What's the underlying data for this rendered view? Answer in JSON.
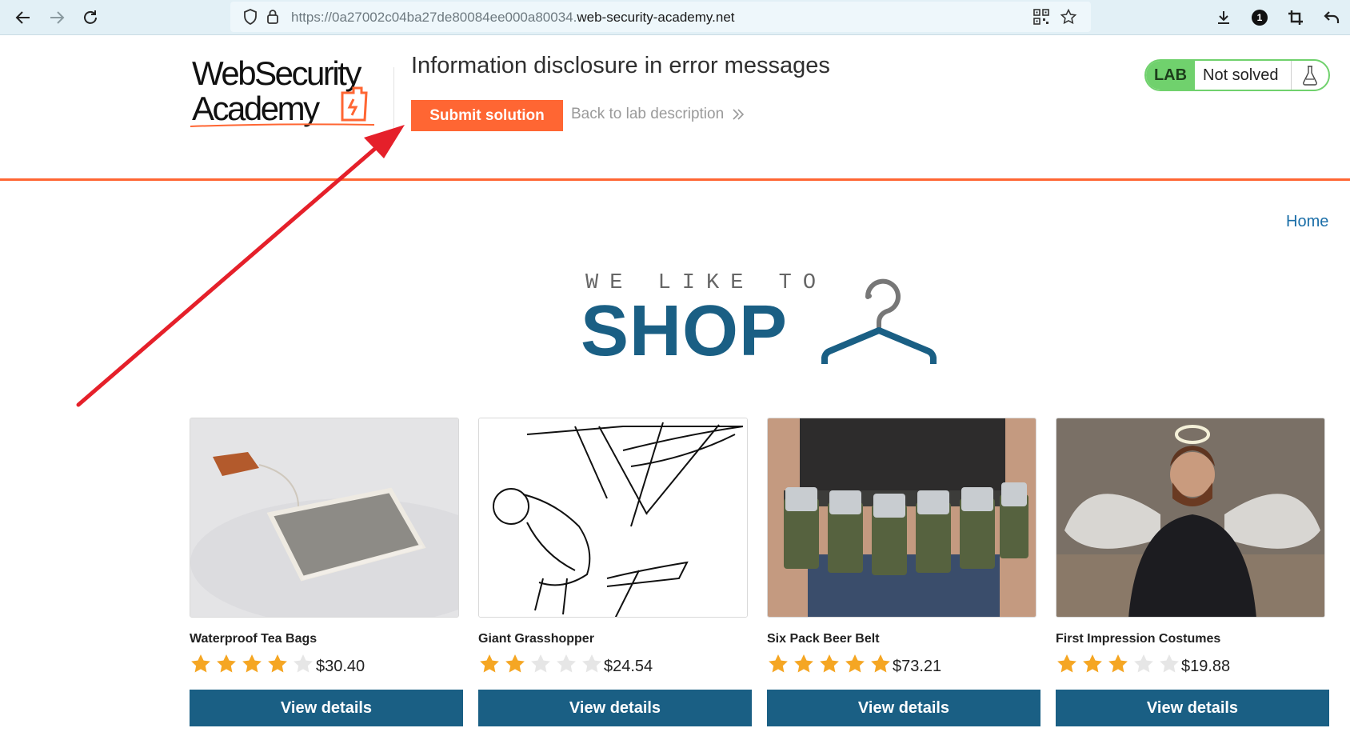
{
  "browser": {
    "url_prefix": "https://0a27002c04ba27de80084ee000a80034.",
    "url_domain": "web-security-academy.net",
    "extensions_badge": "1",
    "icons": [
      "back-arrow-icon",
      "forward-arrow-icon",
      "reload-icon",
      "shield-icon",
      "lock-icon",
      "qr-code-icon",
      "star-icon",
      "download-icon",
      "crop-icon",
      "undo-icon"
    ]
  },
  "lab": {
    "logo_line1": "WebSecurity",
    "logo_line2": "Academy",
    "title": "Information disclosure in error messages",
    "submit_label": "Submit solution",
    "back_label": "Back to lab description",
    "badge": "LAB",
    "status": "Not solved"
  },
  "nav": {
    "home": "Home"
  },
  "banner": {
    "tagline": "WE LIKE TO",
    "headline": "SHOP"
  },
  "products": [
    {
      "name": "Waterproof Tea Bags",
      "rating": 4,
      "price": "$30.40",
      "button": "View details",
      "image": "tea-bag-image"
    },
    {
      "name": "Giant Grasshopper",
      "rating": 2,
      "price": "$24.54",
      "button": "View details",
      "image": "grasshopper-sketch-image"
    },
    {
      "name": "Six Pack Beer Belt",
      "rating": 5,
      "price": "$73.21",
      "button": "View details",
      "image": "beer-belt-image"
    },
    {
      "name": "First Impression Costumes",
      "rating": 3,
      "price": "$19.88",
      "button": "View details",
      "image": "angel-costume-image"
    }
  ],
  "colors": {
    "accent": "#ff6633",
    "primary": "#1a5f84",
    "lab_green": "#70d16d",
    "star_filled": "#f5a623",
    "star_empty": "#e6e6e6",
    "annotation": "#e5202a"
  }
}
